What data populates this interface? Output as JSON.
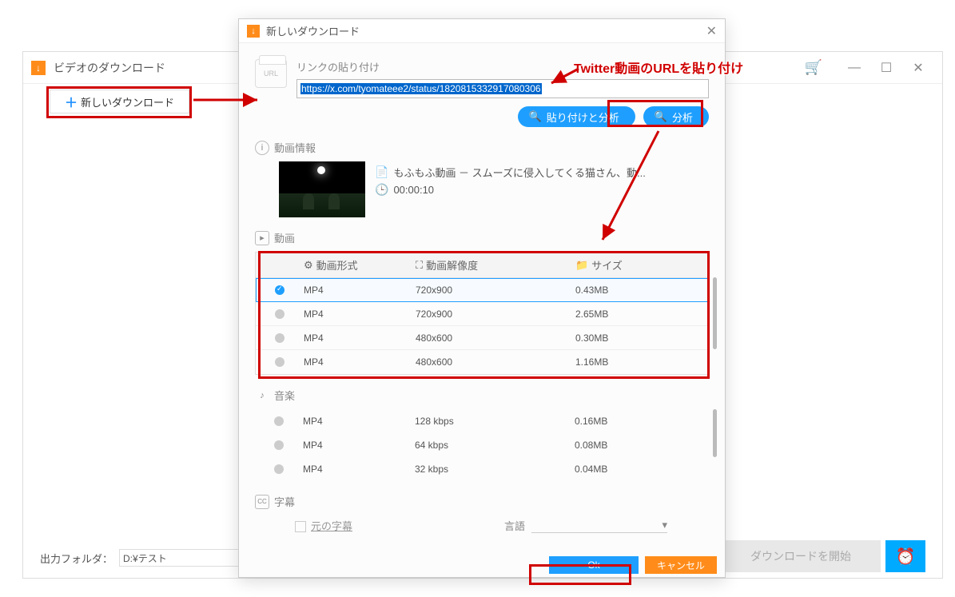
{
  "mainWindow": {
    "title": "ビデオのダウンロード",
    "newDownloadBtn": "新しいダウンロード",
    "outputFolderLabel": "出力フォルダ：",
    "outputFolderValue": "D:¥テスト",
    "startDownloadBtn": "ダウンロードを開始"
  },
  "dialog": {
    "title": "新しいダウンロード",
    "urlIconLabel": "URL",
    "linkPasteLabel": "リンクの貼り付け",
    "urlValue": "https://x.com/tyomateee2/status/1820815332917080306",
    "pasteAnalyzeBtn": "貼り付けと分析",
    "analyzeBtn": "分析",
    "videoInfoHead": "動画情報",
    "videoTitle": "もふもふ動画 － スムーズに侵入してくる猫さん、動...",
    "duration": "00:00:10",
    "videoSectionHead": "動画",
    "formatCol": "動画形式",
    "resolutionCol": "動画解像度",
    "sizeCol": "サイズ",
    "videoRows": [
      {
        "fmt": "MP4",
        "res": "720x900",
        "size": "0.43MB",
        "selected": true
      },
      {
        "fmt": "MP4",
        "res": "720x900",
        "size": "2.65MB",
        "selected": false
      },
      {
        "fmt": "MP4",
        "res": "480x600",
        "size": "0.30MB",
        "selected": false
      },
      {
        "fmt": "MP4",
        "res": "480x600",
        "size": "1.16MB",
        "selected": false
      }
    ],
    "audioSectionHead": "音楽",
    "audioRows": [
      {
        "fmt": "MP4",
        "res": "128 kbps",
        "size": "0.16MB"
      },
      {
        "fmt": "MP4",
        "res": "64 kbps",
        "size": "0.08MB"
      },
      {
        "fmt": "MP4",
        "res": "32 kbps",
        "size": "0.04MB"
      }
    ],
    "captionsHead": "字幕",
    "originalCaptionsLabel": "元の字幕",
    "languageLabel": "言語",
    "okBtn": "Ok",
    "cancelBtn": "キャンセル"
  },
  "annotations": {
    "twitterUrlNote": "Twitter動画のURLを貼り付け"
  }
}
